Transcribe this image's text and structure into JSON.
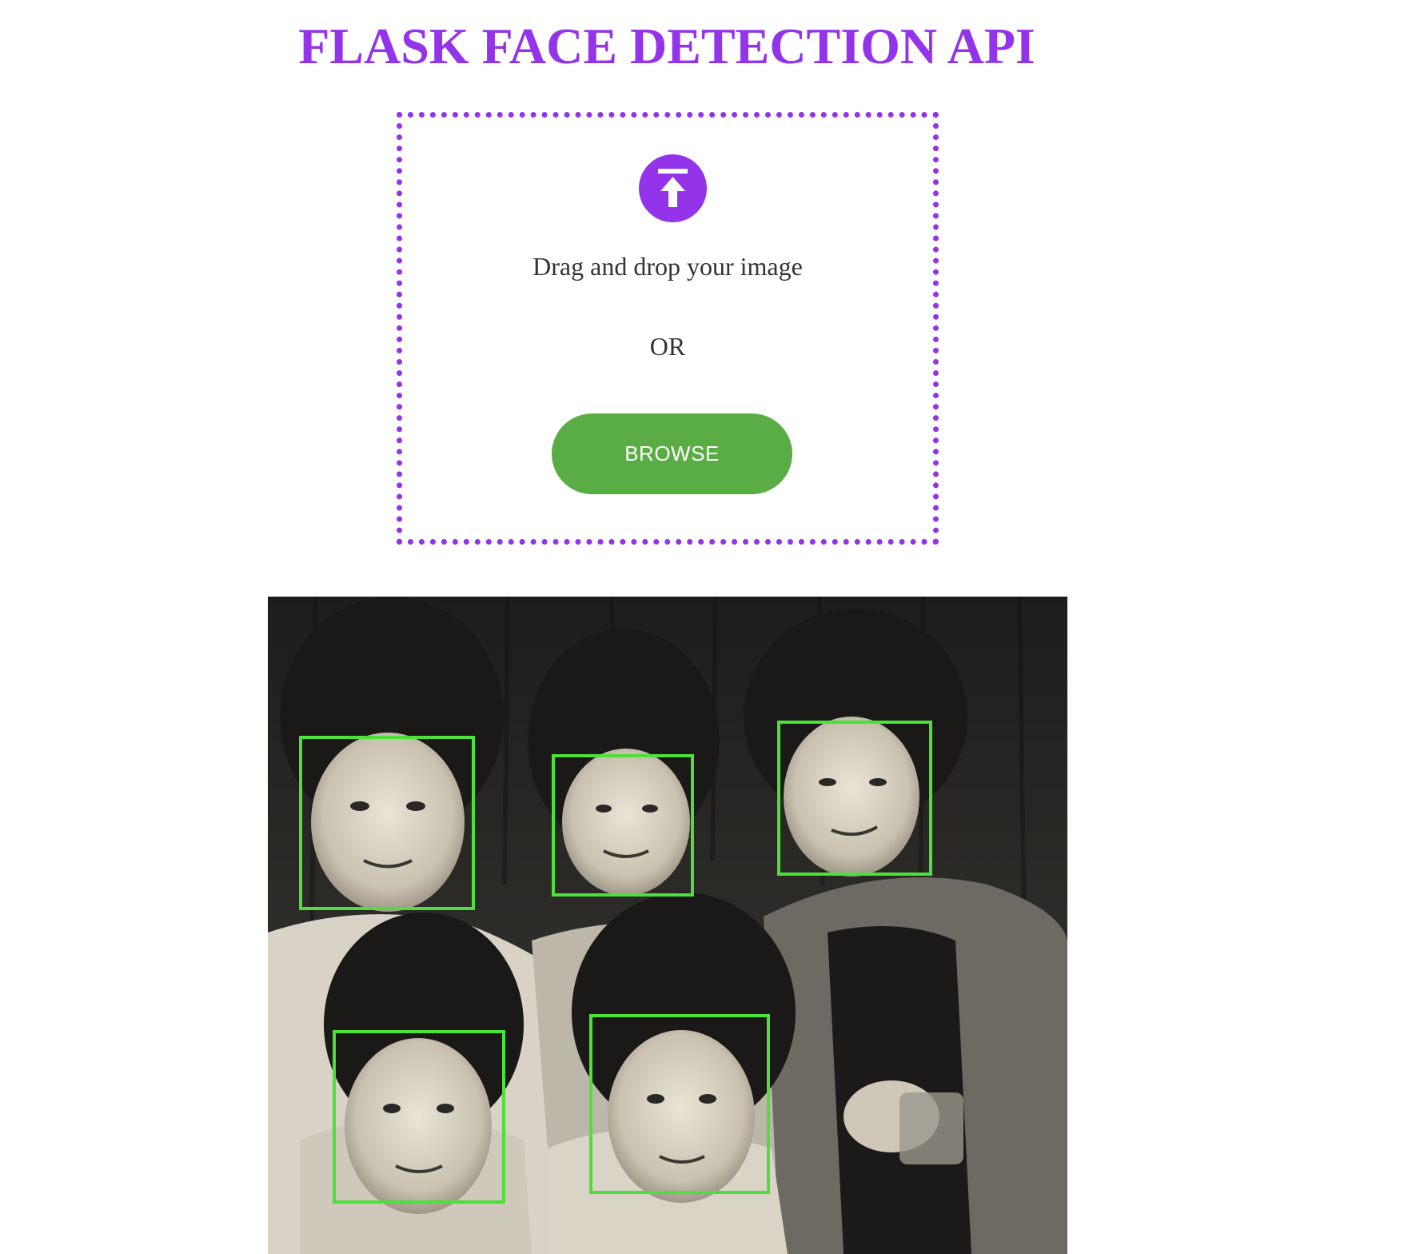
{
  "colors": {
    "accent": "#9333ea",
    "browse_button": "#5aad44",
    "text": "#333333",
    "face_box": "#4ee03a"
  },
  "header": {
    "title": "FLASK FACE DETECTION API"
  },
  "dropzone": {
    "icon": "upload-arrow-icon",
    "drag_text": "Drag and drop your image",
    "or_text": "OR",
    "browse_label": "BROWSE"
  },
  "result": {
    "description": "black-and-white group photo of five people",
    "faces_detected": 5
  }
}
